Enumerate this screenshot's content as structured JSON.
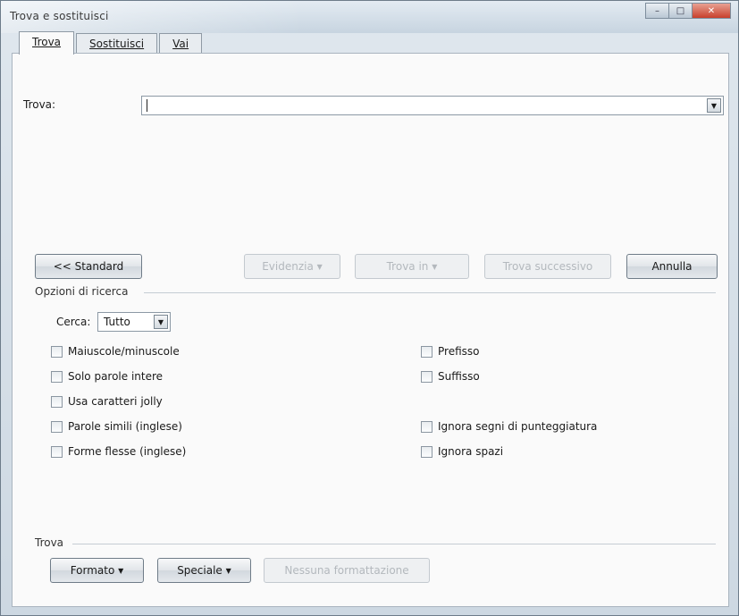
{
  "window": {
    "title": "Trova e sostituisci",
    "controls": {
      "minimize": "–",
      "maximize": "□",
      "close": "✕"
    }
  },
  "tabs": [
    {
      "label": "Trova",
      "active": true
    },
    {
      "label": "Sostituisci",
      "active": false
    },
    {
      "label": "Vai",
      "active": false
    }
  ],
  "find": {
    "label": "Trova:",
    "value": "",
    "dropdown_icon": "triangle-down-icon"
  },
  "buttons": {
    "standard": "<< Standard",
    "evidenzia": "Evidenzia",
    "trova_in": "Trova in",
    "trova_successivo": "Trova successivo",
    "annulla": "Annulla",
    "dropdown_arrow": "▼"
  },
  "options": {
    "group_title": "Opzioni di ricerca",
    "cerca_label": "Cerca:",
    "cerca_value": "Tutto",
    "left_checkboxes": [
      {
        "label": "Maiuscole/minuscole",
        "checked": false
      },
      {
        "label": "Solo parole intere",
        "checked": false
      },
      {
        "label": "Usa caratteri jolly",
        "checked": false
      },
      {
        "label": "Parole simili (inglese)",
        "checked": false
      },
      {
        "label": "Forme flesse (inglese)",
        "checked": false
      }
    ],
    "right_checkboxes": [
      {
        "label": "Prefisso",
        "checked": false
      },
      {
        "label": "Suffisso",
        "checked": false
      },
      {
        "label": "Ignora segni di punteggiatura",
        "checked": false
      },
      {
        "label": "Ignora spazi",
        "checked": false
      }
    ]
  },
  "find_section": {
    "title": "Trova",
    "formato": "Formato",
    "speciale": "Speciale",
    "nessuna_formattazione": "Nessuna formattazione"
  }
}
